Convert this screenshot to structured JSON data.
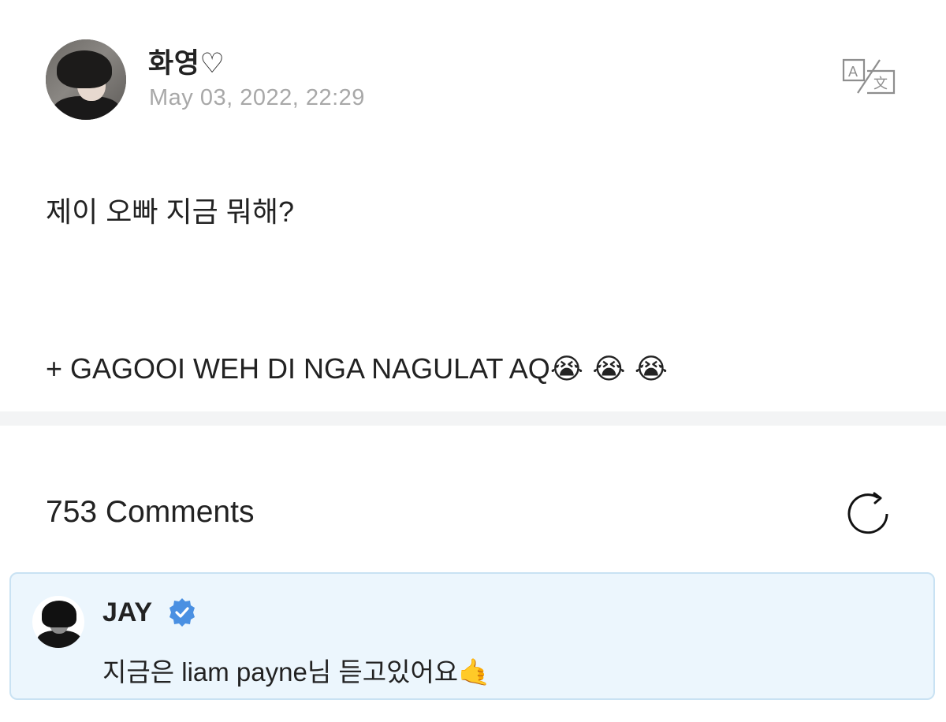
{
  "post": {
    "author": "화영♡",
    "timestamp": "May 03, 2022, 22:29",
    "text_line1": "제이 오빠 지금 뭐해?",
    "text_line2": "+ GAGOOI WEH DI NGA NAGULAT AQ",
    "line2_emojis": "😭 😭 😭",
    "translate_icon": "translate-icon"
  },
  "comments": {
    "header": "753 Comments",
    "refresh_icon": "refresh-icon",
    "items": [
      {
        "author": "JAY",
        "verified": true,
        "text": "지금은 liam payne님 듣고있어요",
        "emoji": "🤙"
      }
    ]
  },
  "colors": {
    "timestamp": "#a8a8a8",
    "divider": "#f3f4f5",
    "comment_bg": "#ecf6fd",
    "comment_border": "#c9e2f3",
    "verified_badge": "#4a90e2"
  }
}
